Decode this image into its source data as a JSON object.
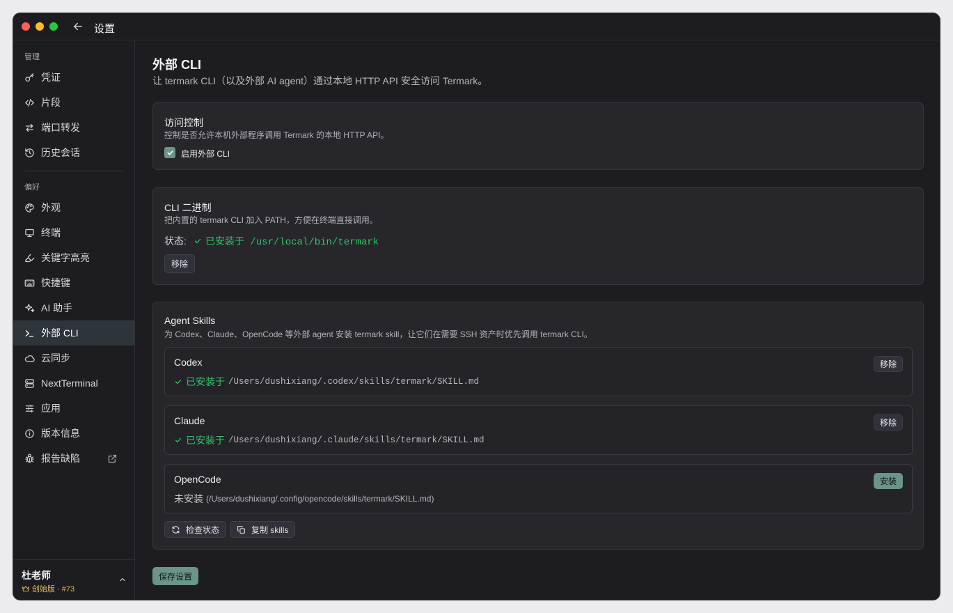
{
  "window": {
    "title": "设置"
  },
  "sidebar": {
    "section_manage": "管理",
    "manage_items": [
      {
        "label": "凭证",
        "icon": "key-icon"
      },
      {
        "label": "片段",
        "icon": "code-icon"
      },
      {
        "label": "端口转发",
        "icon": "arrows-icon"
      },
      {
        "label": "历史会话",
        "icon": "history-icon"
      }
    ],
    "section_prefs": "偏好",
    "pref_items": [
      {
        "label": "外观",
        "icon": "palette-icon"
      },
      {
        "label": "终端",
        "icon": "monitor-icon"
      },
      {
        "label": "关键字高亮",
        "icon": "highlighter-icon"
      },
      {
        "label": "快捷键",
        "icon": "keyboard-icon"
      },
      {
        "label": "AI 助手",
        "icon": "sparkles-icon"
      },
      {
        "label": "外部 CLI",
        "icon": "terminal-prompt-icon",
        "active": true
      },
      {
        "label": "云同步",
        "icon": "cloud-icon"
      },
      {
        "label": "NextTerminal",
        "icon": "server-icon"
      },
      {
        "label": "应用",
        "icon": "sliders-icon"
      },
      {
        "label": "版本信息",
        "icon": "info-icon"
      },
      {
        "label": "报告缺陷",
        "icon": "bug-icon"
      }
    ],
    "user": {
      "name": "杜老师",
      "tier": "创始版 · #73"
    }
  },
  "main": {
    "title": "外部 CLI",
    "subtitle": "让 termark CLI（以及外部 AI agent）通过本地 HTTP API 安全访问 Termark。",
    "access": {
      "title": "访问控制",
      "desc": "控制是否允许本机外部程序调用 Termark 的本地 HTTP API。",
      "checkbox_label": "启用外部 CLI",
      "checked": true
    },
    "binary": {
      "title": "CLI 二进制",
      "desc": "把内置的 termark CLI 加入 PATH，方便在终端直接调用。",
      "status_label": "状态:",
      "status_value": "已安装于 /usr/local/bin/termark",
      "remove_label": "移除"
    },
    "skills": {
      "title": "Agent Skills",
      "desc": "为 Codex、Claude、OpenCode 等外部 agent 安装 termark skill，让它们在需要 SSH 资产时优先调用 termark CLI。",
      "items": [
        {
          "name": "Codex",
          "status": "已安装于",
          "path": "/Users/dushixiang/.codex/skills/termark/SKILL.md",
          "button": "移除"
        },
        {
          "name": "Claude",
          "status": "已安装于",
          "path": "/Users/dushixiang/.claude/skills/termark/SKILL.md",
          "button": "移除"
        },
        {
          "name": "OpenCode",
          "status": "未安装",
          "path": "(/Users/dushixiang/.config/opencode/skills/termark/SKILL.md)",
          "button": "安装"
        }
      ],
      "check_label": "检查状态",
      "copy_label": "复制 skills"
    },
    "save_label": "保存设置"
  },
  "colors": {
    "accent": "#6b948a",
    "success": "#35c46a",
    "background": "#1d1d21",
    "tier": "#e6b84a"
  }
}
